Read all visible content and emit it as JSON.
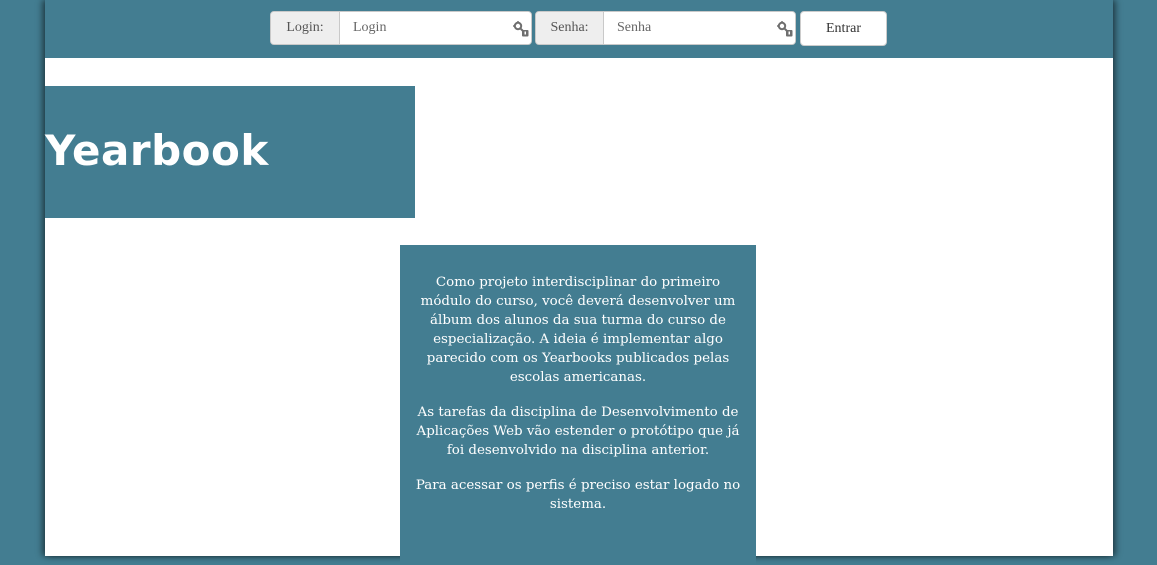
{
  "login_form": {
    "login_label": "Login:",
    "login_placeholder": "Login",
    "senha_label": "Senha:",
    "senha_placeholder": "Senha",
    "submit_label": "Entrar"
  },
  "banner": {
    "title": "Yearbook"
  },
  "info": {
    "paragraphs": [
      "Como projeto interdisciplinar do primeiro módulo do curso, você deverá desenvolver um álbum dos alunos da sua turma do curso de especialização. A ideia é implementar algo parecido com os Yearbooks publicados pelas escolas americanas.",
      "As tarefas da disciplina de Desenvolvimento de Aplicações Web vão estender o protótipo que já foi desenvolvido na disciplina anterior.",
      "Para acessar os perfis é preciso estar logado no sistema."
    ]
  },
  "colors": {
    "brand": "#437d91",
    "page_background": "#ffffff"
  },
  "icons": {
    "field_icon": "key-icon"
  }
}
